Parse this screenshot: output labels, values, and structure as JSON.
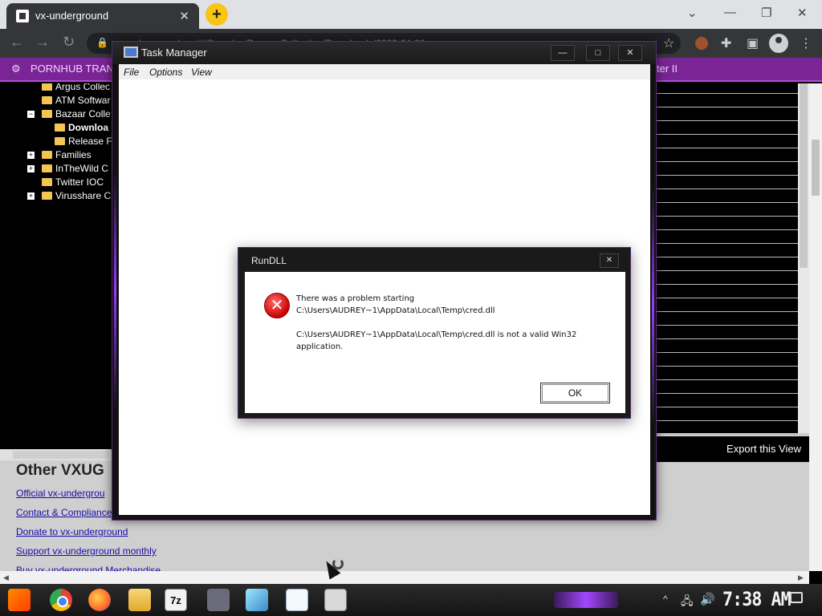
{
  "browser": {
    "tab_title": "vx-underground",
    "tab_close": "✕",
    "new_tab": "+",
    "win_minimize": "—",
    "win_restore": "❐",
    "win_close": "✕",
    "nav_back": "←",
    "nav_forward": "→",
    "nav_reload": "↻",
    "lock": "🔒",
    "url": "vx-underground.org/#/Samples/Bazaar Collection/Downloads/2022-04-30",
    "bookmark_star": "☆",
    "bookmarks": [
      "PORNHUB TRANS",
      "ter II"
    ]
  },
  "page": {
    "tree": [
      {
        "label": "Argus Collec",
        "level": 0,
        "expander": ""
      },
      {
        "label": "ATM Softwar",
        "level": 0,
        "expander": ""
      },
      {
        "label": "Bazaar Colle",
        "level": 0,
        "expander": "−"
      },
      {
        "label": "Downloa",
        "level": 1,
        "expander": ""
      },
      {
        "label": "Release F",
        "level": 1,
        "expander": ""
      },
      {
        "label": "Families",
        "level": 0,
        "expander": "+"
      },
      {
        "label": "InTheWild C",
        "level": 0,
        "expander": "+"
      },
      {
        "label": "Twitter IOC",
        "level": 0,
        "expander": ""
      },
      {
        "label": "Virusshare C",
        "level": 0,
        "expander": "+"
      }
    ],
    "export_button": "Export this View",
    "other_heading": "Other VXUG",
    "links": [
      "Official vx-undergrou",
      "Contact & Compliance",
      "Donate to vx-underground",
      "Support vx-underground monthly",
      "Buy vx-underground Merchandise"
    ]
  },
  "taskmgr": {
    "title": "Task Manager",
    "menu": [
      "File",
      "Options",
      "View"
    ],
    "minimize": "—",
    "maximize": "□",
    "close": "✕"
  },
  "rundll": {
    "title": "RunDLL",
    "close": "✕",
    "icon": "✕",
    "line1": "There was a problem starting",
    "line2": "C:\\Users\\AUDREY~1\\AppData\\Local\\Temp\\cred.dll",
    "line3": "C:\\Users\\AUDREY~1\\AppData\\Local\\Temp\\cred.dll is not a valid Win32",
    "line4": "application.",
    "ok": "OK"
  },
  "taskbar": {
    "sevenzip": "7z",
    "tray_arrow": "^",
    "network": "🖧",
    "volume": "🔊",
    "clock": "7:38 AM"
  },
  "colors": {
    "accent_purple": "#7a2496",
    "glow": "#9b3cff"
  }
}
